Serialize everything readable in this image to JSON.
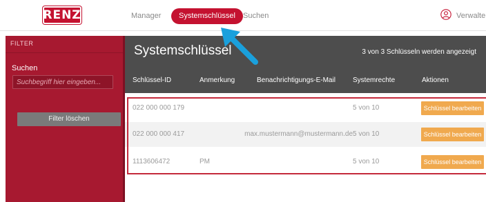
{
  "brand": {
    "logo_text": "RENZ"
  },
  "nav": {
    "items": [
      {
        "label": "Manager"
      },
      {
        "label": "Systemschlüssel",
        "active": true
      },
      {
        "label": "Suchen"
      }
    ],
    "user": {
      "label": "Verwalter",
      "icon": "user-icon"
    }
  },
  "sidebar": {
    "section_label": "FILTER",
    "search_label": "Suchen",
    "search_placeholder": "Suchbegriff hier eingeben...",
    "search_value": "",
    "clear_button": "Filter löschen"
  },
  "main": {
    "title": "Systemschlüssel",
    "count_text": "3 von 3 Schlüsseln werden angezeigt",
    "columns": [
      "Schlüssel-ID",
      "Anmerkung",
      "Benachrichtigungs-E-Mail",
      "Systemrechte",
      "Aktionen"
    ],
    "rows": [
      {
        "id": "022 000 000 179",
        "note": "",
        "email": "",
        "rights": "5 von 10",
        "action": "Schlüssel bearbeiten"
      },
      {
        "id": "022 000 000 417",
        "note": "",
        "email": "max.mustermann@mustermann.de",
        "rights": "5 von 10",
        "action": "Schlüssel bearbeiten"
      },
      {
        "id": "1113606472",
        "note": "PM",
        "email": "",
        "rights": "5 von 10",
        "action": "Schlüssel bearbeiten"
      }
    ]
  },
  "colors": {
    "brand_red": "#c41230",
    "sidebar_red": "#a71930",
    "header_gray": "#4d4d4d",
    "action_orange": "#f0a94e",
    "annotation_blue": "#1aa0dc"
  }
}
